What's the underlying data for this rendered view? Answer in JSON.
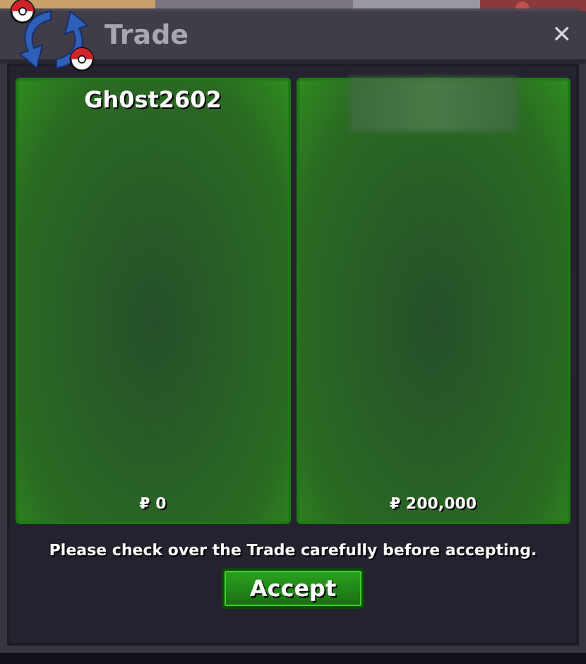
{
  "window": {
    "title": "Trade",
    "close": "✕"
  },
  "offers": [
    {
      "trader": "Gh0st2602",
      "name_hidden": false,
      "money": "₽ 0"
    },
    {
      "name_hidden": true,
      "money": "₽ 200,000"
    }
  ],
  "notice": "Please check over the Trade carefully before accepting.",
  "accept_button": "Accept"
}
